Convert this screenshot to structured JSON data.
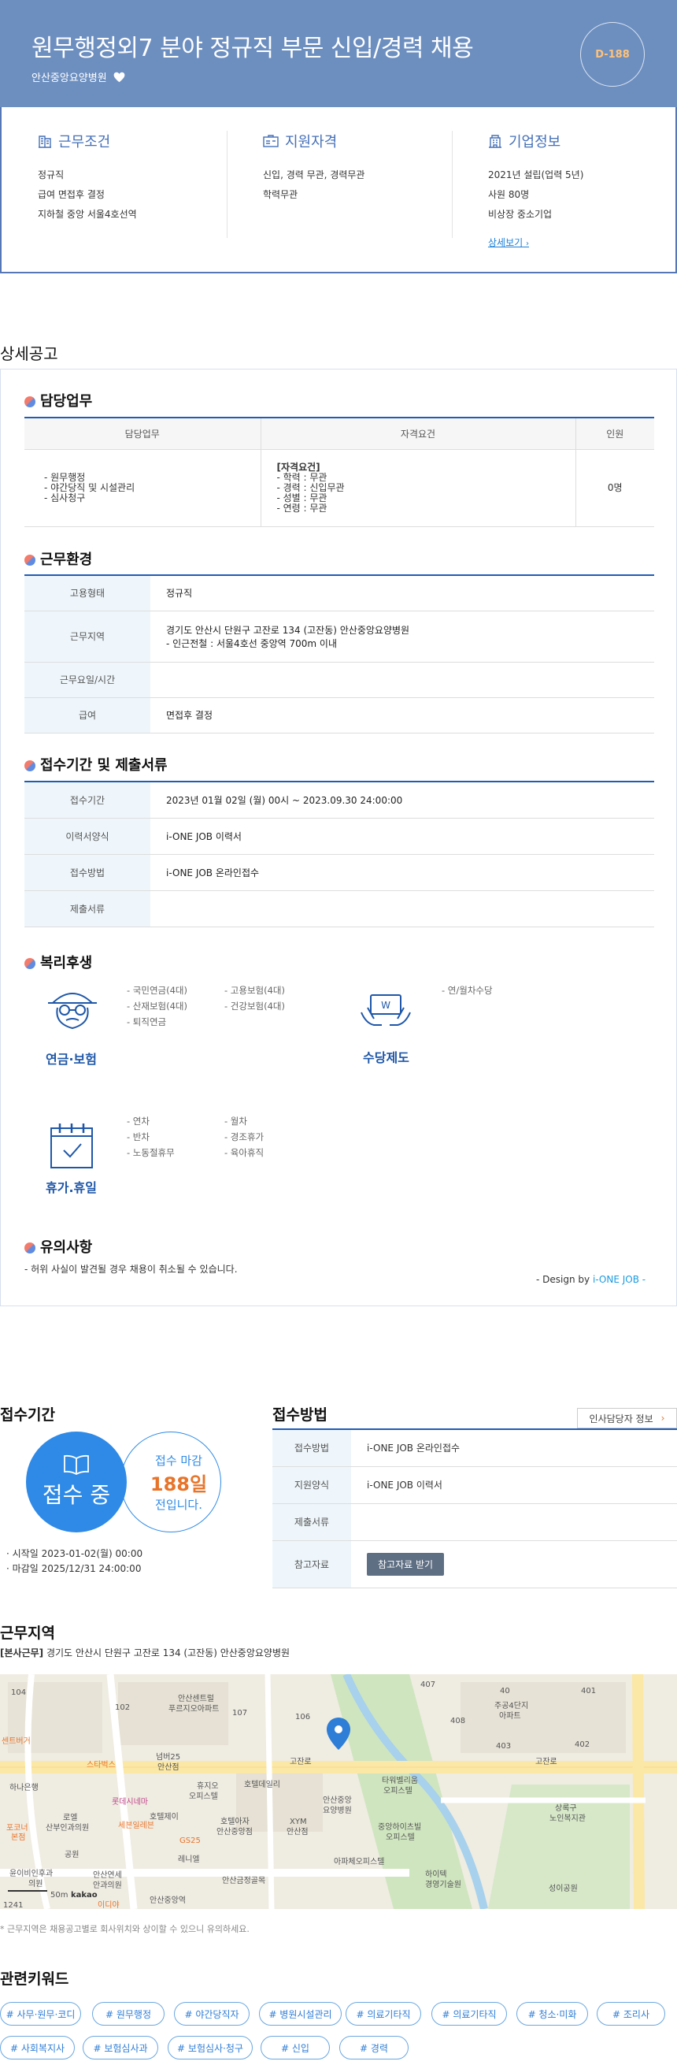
{
  "header": {
    "title": "원무행정외7 분야 정규직 부문 신입/경력 채용",
    "company": "안산중앙요양병원",
    "dday": "D-188"
  },
  "summary": {
    "work": {
      "title": "근무조건",
      "lines": [
        "정규직",
        "급여 면접후 결정",
        "지하철 중앙 서울4호선역"
      ]
    },
    "qual": {
      "title": "지원자격",
      "lines": [
        "신입, 경력 무관, 경력무관",
        "학력무관"
      ]
    },
    "company": {
      "title": "기업정보",
      "lines": [
        "2021년 설립(업력 5년)",
        "사원 80명",
        "비상장 중소기업"
      ],
      "more": "상세보기"
    }
  },
  "detail": {
    "heading": "상세공고",
    "duty": {
      "title": "담당업무",
      "headers": [
        "담당업무",
        "자격요건",
        "인원"
      ],
      "tasks": [
        "- 원무행정",
        "- 야간당직 및 시설관리",
        "- 심사청구"
      ],
      "req_title": "[자격요건]",
      "reqs": [
        "- 학력 : 무관",
        "- 경력 : 신입무관",
        "- 성별 : 무관",
        "- 연령 : 무관"
      ],
      "headcount": "0명"
    },
    "env": {
      "title": "근무환경",
      "rows": [
        {
          "k": "고용형태",
          "v": "정규직"
        },
        {
          "k": "근무지역",
          "v": "경기도 안산시 단원구 고잔로 134 (고잔동) 안산중앙요양병원",
          "v2": "- 인근전철 : 서울4호선 중앙역 700m 이내"
        },
        {
          "k": "근무요일/시간",
          "v": ""
        },
        {
          "k": "급여",
          "v": "면접후 결정"
        }
      ]
    },
    "period": {
      "title": "접수기간 및 제출서류",
      "rows": [
        {
          "k": "접수기간",
          "v": "2023년 01월 02일 (월) 00시 ~ 2023.09.30 24:00:00"
        },
        {
          "k": "이력서양식",
          "v": "i-ONE JOB 이력서"
        },
        {
          "k": "접수방법",
          "v": "i-ONE JOB 온라인접수"
        },
        {
          "k": "제출서류",
          "v": ""
        }
      ]
    },
    "welfare": {
      "title": "복리후생",
      "pension": {
        "label": "연금·보험",
        "items": [
          "- 국민연금(4대)",
          "- 고용보험(4대)",
          "- 산재보험(4대)",
          "- 건강보험(4대)",
          "- 퇴직연금"
        ]
      },
      "allowance": {
        "label": "수당제도",
        "items": [
          "- 연/월차수당"
        ]
      },
      "vacation": {
        "label": "휴가.휴일",
        "items": [
          "- 연차",
          "- 월차",
          "- 반차",
          "- 경조휴가",
          "- 노동절휴무",
          "- 육아휴직"
        ]
      }
    },
    "notice": {
      "title": "유의사항",
      "text": "- 허위 사실이 발견될 경우 채용이 취소될 수 있습니다.",
      "design_prefix": "- Design by ",
      "design_brand": "i-ONE JOB -"
    }
  },
  "apply_period": {
    "title": "접수기간",
    "status": "접수 중",
    "deadline_label": "접수 마감",
    "days": "188일",
    "days_suffix": "전입니다.",
    "start": "시작일 2023-01-02(월) 00:00",
    "end": "마감일 2025/12/31 24:00:00"
  },
  "apply_method": {
    "title": "접수방법",
    "hr_button": "인사담당자 정보",
    "rows": [
      {
        "k": "접수방법",
        "v": "i-ONE JOB 온라인접수"
      },
      {
        "k": "지원양식",
        "v": "i-ONE JOB 이력서"
      },
      {
        "k": "제출서류",
        "v": ""
      },
      {
        "k": "참고자료",
        "v": "참고자료 받기"
      }
    ]
  },
  "location": {
    "title": "근무지역",
    "tag": "[본사근무]",
    "address": "경기도 안산시 단원구 고잔로 134 (고잔동) 안산중앙요양병원",
    "note": "* 근무지역은 채용공고별로 회사위치와 상이할 수 있으니 유의하세요.",
    "map_labels": [
      "104",
      "102",
      "안산센트럴",
      "푸르지오아파트",
      "107",
      "106",
      "407",
      "408",
      "40",
      "주공4단지",
      "아파트",
      "401",
      "403",
      "402",
      "센트버거",
      "넘버25",
      "안산점",
      "스타벅스",
      "고잔로",
      "하나은행",
      "롯데시네마",
      "휴지오",
      "오피스텔",
      "호텔데일리",
      "호텔제이",
      "호텔아자",
      "안산중앙점",
      "XYM",
      "안산점",
      "안산중앙",
      "요양병원",
      "타워벨리움",
      "오피스텔",
      "중앙하이츠빌",
      "오피스텔",
      "고잔로",
      "상록구",
      "노인복지관",
      "포코너",
      "본점",
      "로엘",
      "산부인과의원",
      "세븐일레븐",
      "공원",
      "GS25",
      "레니엘",
      "아파체오피스텔",
      "하이텍",
      "경영기술원",
      "성이공원",
      "윤이비인후과",
      "의원",
      "안산연세",
      "안과의원",
      "안산금정골목",
      "안산중앙역",
      "50m",
      "kakao",
      "1241",
      "이디야"
    ]
  },
  "keywords": {
    "title": "관련키워드",
    "items": [
      "# 사무·원무·코디",
      "# 원무행정",
      "# 야간당직자",
      "# 병원시설관리",
      "# 의료기타직",
      "# 의료기타직",
      "# 청소·미화",
      "# 조리사",
      "# 사회복지사",
      "# 보험심사과",
      "# 보험심사·청구",
      "# 신입",
      "# 경력"
    ]
  },
  "colors": {
    "brand": "#6d8fc0",
    "accent": "#2e8ae6",
    "link": "#1a7fd6",
    "warning": "#e8742a"
  }
}
